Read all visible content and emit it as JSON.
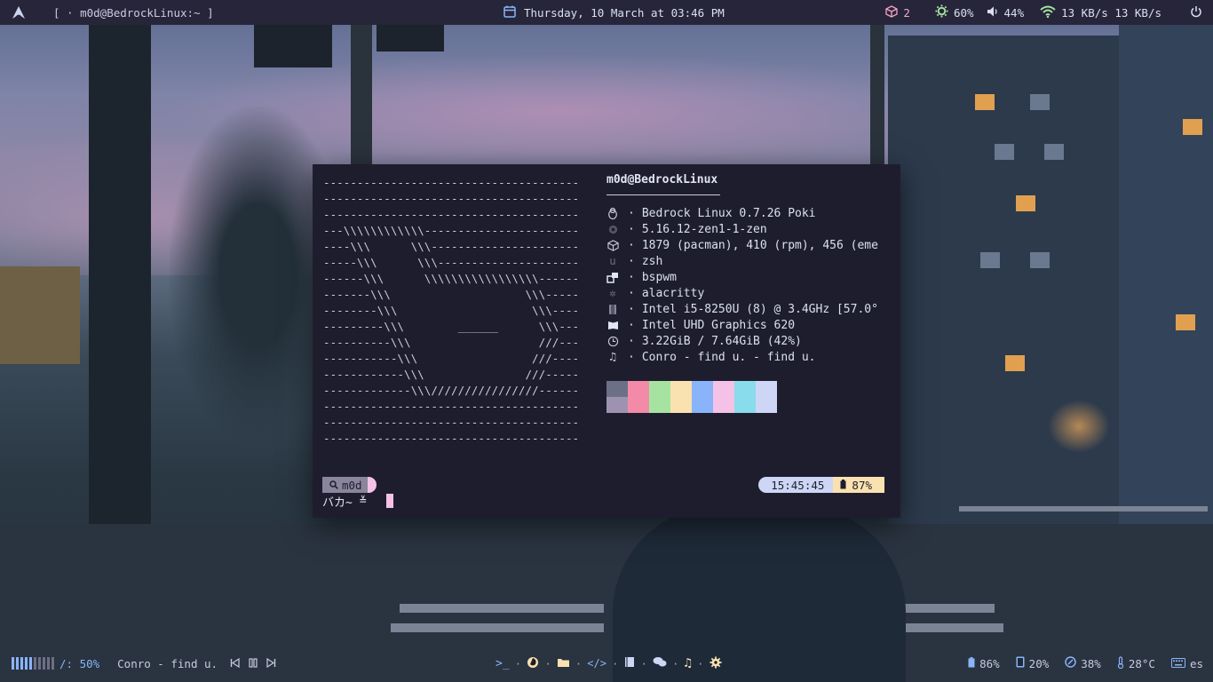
{
  "topbar": {
    "logo_icon": "arch-logo-icon",
    "window_title": "[ · m0d@BedrockLinux:~ ]",
    "date_icon": "calendar-icon",
    "datetime": "Thursday, 10 March at 03:46 PM",
    "updates_icon": "package-icon",
    "updates_count": "2",
    "brightness_icon": "brightness-icon",
    "brightness": "60%",
    "volume_icon": "volume-icon",
    "volume": "44%",
    "network_icon": "wifi-icon",
    "network_speed": "13 KB/s 13 KB/s",
    "power_icon": "power-icon"
  },
  "terminal": {
    "ascii_art": [
      "--------------------------------------",
      "--------------------------------------",
      "--------------------------------------",
      "---\\\\\\\\\\\\\\\\\\\\\\\\-----------------------",
      "----\\\\\\      \\\\\\----------------------",
      "-----\\\\\\      \\\\\\---------------------",
      "------\\\\\\      \\\\\\\\\\\\\\\\\\\\\\\\\\\\\\\\\\------",
      "-------\\\\\\                    \\\\\\-----",
      "--------\\\\\\                    \\\\\\----",
      "---------\\\\\\        ______      \\\\\\---",
      "----------\\\\\\                   ///---",
      "-----------\\\\\\                 ///----",
      "------------\\\\\\               ///-----",
      "-------------\\\\\\////////////////------",
      "--------------------------------------",
      "--------------------------------------",
      "--------------------------------------"
    ],
    "user_host": "m0d@BedrockLinux",
    "info": [
      {
        "icon": "penguin-icon",
        "value": "Bedrock Linux 0.7.26 Poki"
      },
      {
        "icon": "gear-kernel-icon",
        "value": "5.16.12-zen1-1-zen"
      },
      {
        "icon": "cube-icon",
        "value": "1879 (pacman), 410 (rpm), 456 (eme"
      },
      {
        "icon": "shell-icon",
        "value": "zsh"
      },
      {
        "icon": "windows-icon",
        "value": "bspwm"
      },
      {
        "icon": "snowflake-icon",
        "value": "alacritty"
      },
      {
        "icon": "cpu-icon",
        "value": "Intel i5-8250U (8) @ 3.4GHz [57.0°"
      },
      {
        "icon": "gpu-icon",
        "value": "Intel UHD Graphics 620"
      },
      {
        "icon": "clock-icon",
        "value": "3.22GiB / 7.64GiB (42%)"
      },
      {
        "icon": "music-note-icon",
        "value": "Conro - find u. - find u."
      }
    ],
    "palette": [
      "#6c7086",
      "#f38ba8",
      "#a6e3a1",
      "#f9e2af",
      "#89b4fa",
      "#f5c2e7",
      "#89dceb",
      "#cdd6f4",
      "#9d93b0",
      "#f38ba8",
      "#a6e3a1",
      "#f9e2af",
      "#89b4fa",
      "#f5c2e7",
      "#89dceb",
      "#cdd6f4"
    ],
    "prompt_icon": "search-icon",
    "prompt_user": "m0d",
    "prompt_text": "バカ~",
    "prompt_symbol": "≚",
    "rprompt_time": "15:45:45",
    "rprompt_battery_icon": "battery-icon",
    "rprompt_battery": "87%"
  },
  "bottombar": {
    "volume_bars_level": 0.5,
    "volume_label": "/: 50%",
    "song": "Conro - find u.",
    "media": [
      "previous-icon",
      "pause-icon",
      "next-icon"
    ],
    "launchers": [
      "terminal-icon",
      "firefox-icon",
      "folder-icon",
      "code-icon",
      "book-icon",
      "chat-icon",
      "music-icon",
      "settings-icon"
    ],
    "launcher_separator": "·",
    "battery": "86%",
    "disk": "20%",
    "cpu": "38%",
    "temperature": "28°C",
    "keyboard_layout": "es"
  }
}
